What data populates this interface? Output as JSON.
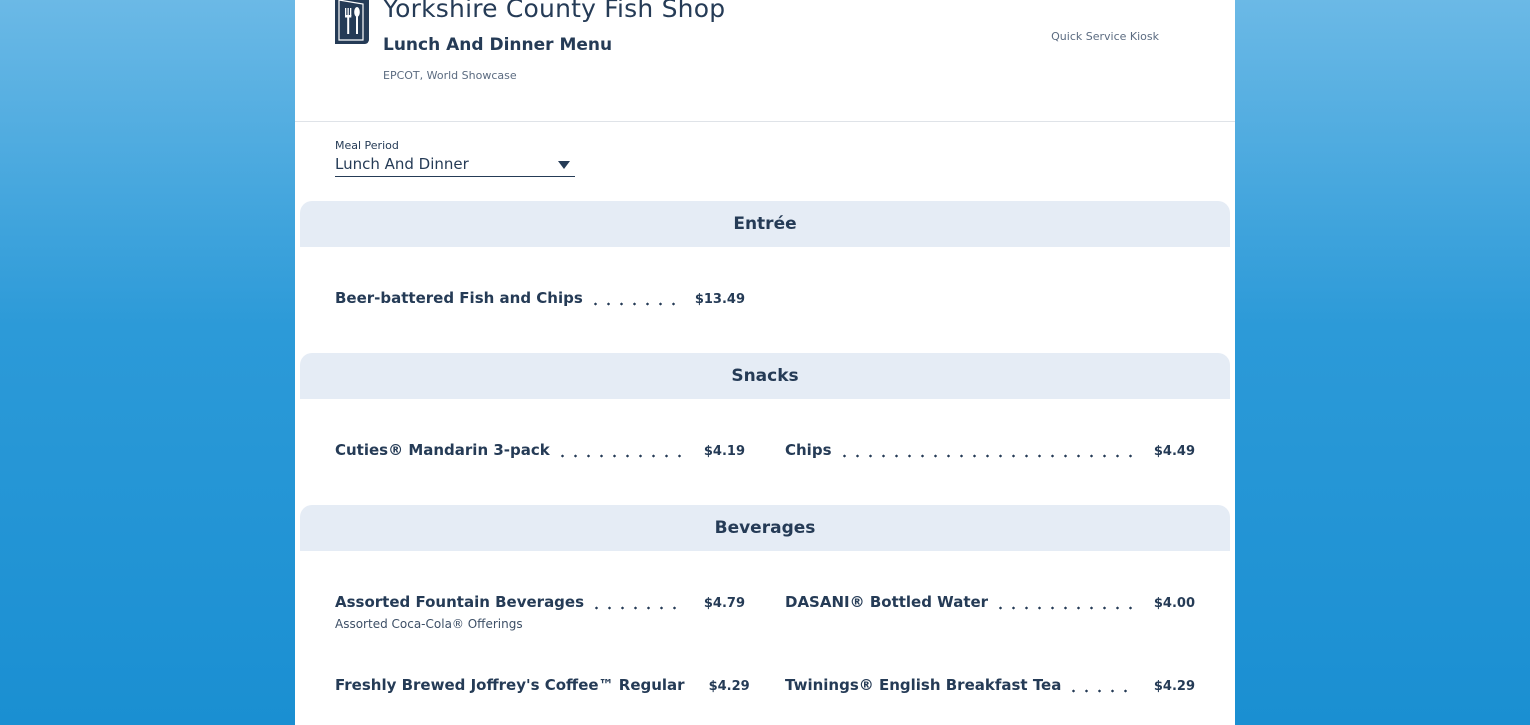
{
  "restaurant": {
    "name": "Yorkshire County Fish Shop",
    "menu_title": "Lunch And Dinner Menu",
    "location": "EPCOT, World Showcase",
    "service_type": "Quick Service Kiosk"
  },
  "meal_period": {
    "label": "Meal Period",
    "selected": "Lunch And Dinner"
  },
  "sections": [
    {
      "title": "Entrée",
      "items": [
        {
          "name": "Beer-battered Fish and Chips",
          "price": "$13.49"
        }
      ]
    },
    {
      "title": "Snacks",
      "items": [
        {
          "name": "Cuties® Mandarin 3-pack",
          "price": "$4.19"
        },
        {
          "name": "Chips",
          "price": "$4.49"
        }
      ]
    },
    {
      "title": "Beverages",
      "items": [
        {
          "name": "Assorted Fountain Beverages",
          "price": "$4.79",
          "description": "Assorted Coca-Cola® Offerings"
        },
        {
          "name": "DASANI® Bottled Water",
          "price": "$4.00"
        },
        {
          "name": "Freshly Brewed Joffrey's Coffee™ Regular",
          "price": "$4.29"
        },
        {
          "name": "Twinings® English Breakfast Tea",
          "price": "$4.29"
        }
      ]
    }
  ],
  "icons": {
    "logo": "restaurant-utensils-icon",
    "dropdown": "caret-down-icon"
  },
  "colors": {
    "text_primary": "#253b56",
    "section_bg": "#e5ecf5",
    "page_bg": "#1a8fd2"
  }
}
